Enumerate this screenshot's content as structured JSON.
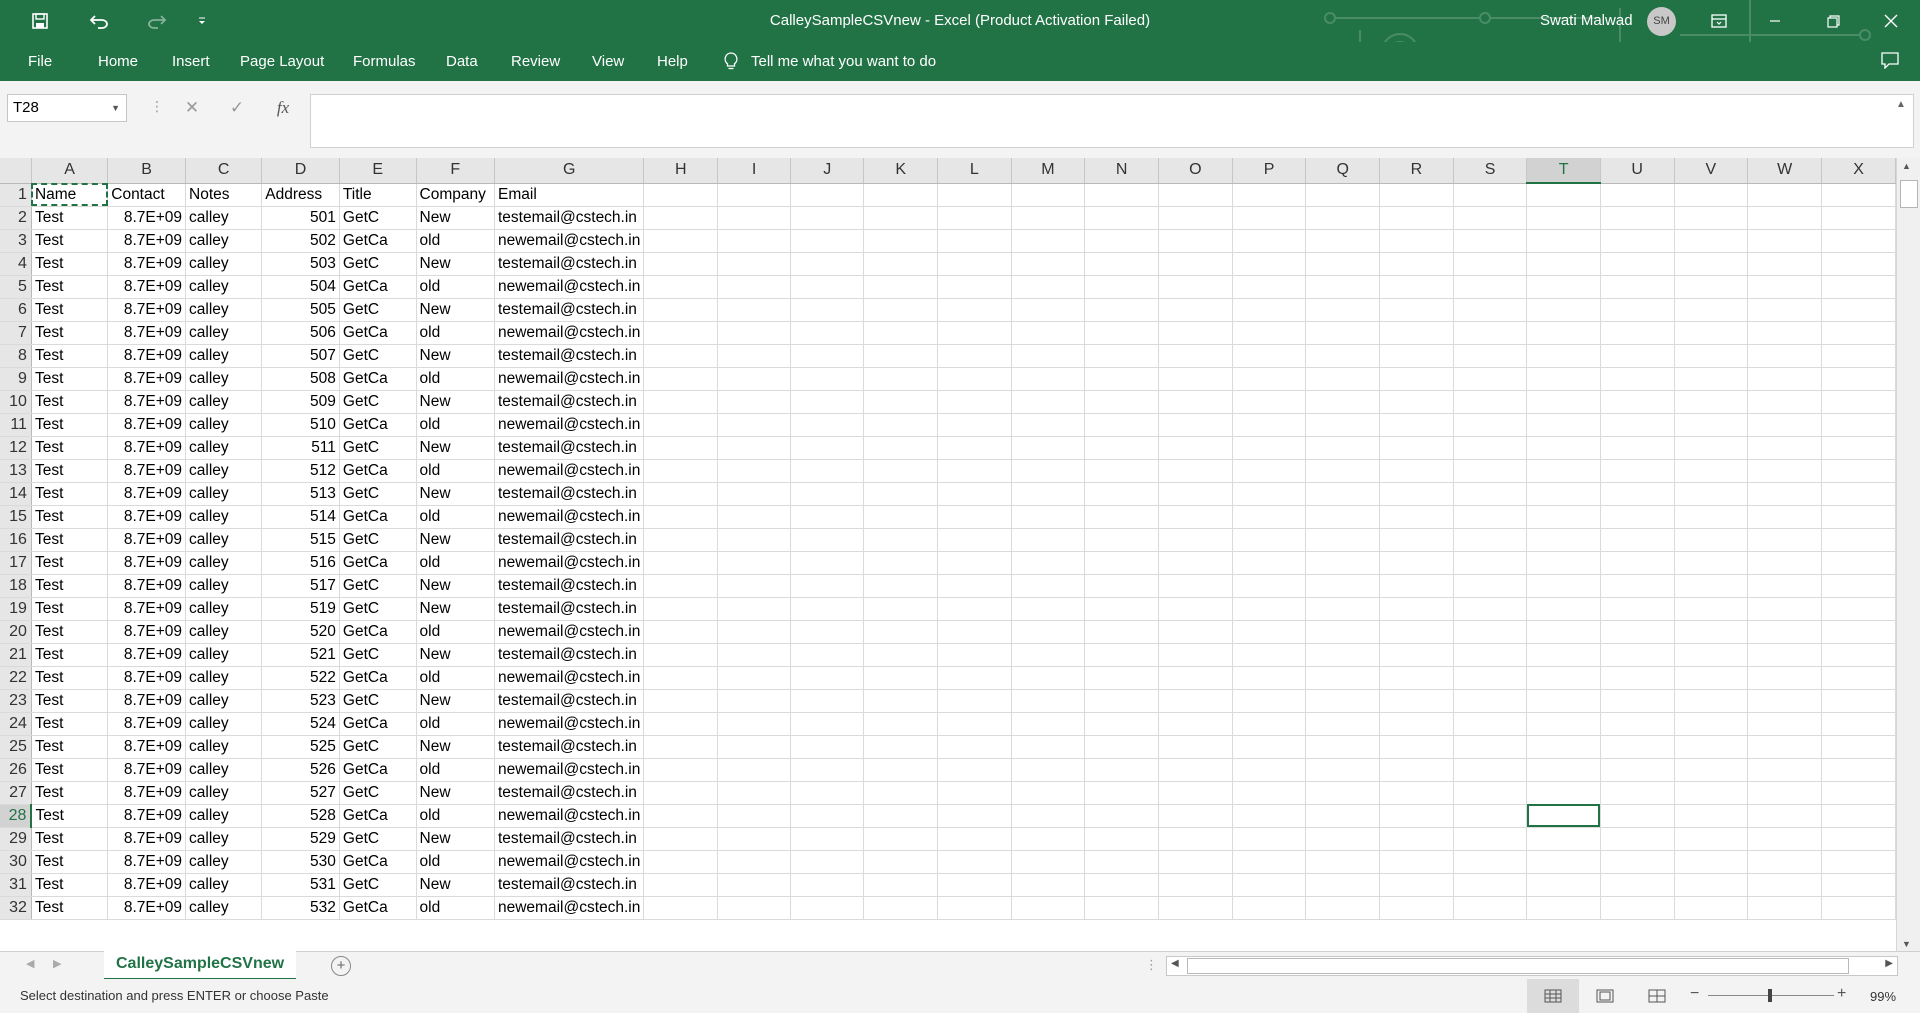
{
  "window": {
    "title": "CalleySampleCSVnew  -  Excel (Product Activation Failed)",
    "user_name": "Swati Malwad",
    "user_initials": "SM"
  },
  "ribbon": {
    "tabs": [
      "File",
      "Home",
      "Insert",
      "Page Layout",
      "Formulas",
      "Data",
      "Review",
      "View",
      "Help"
    ],
    "tell_me": "Tell me what you want to do"
  },
  "formula_bar": {
    "name_box": "T28",
    "cancel_icon": "✕",
    "enter_icon": "✓",
    "fx_label": "fx",
    "formula": ""
  },
  "sheet": {
    "columns": [
      "A",
      "B",
      "C",
      "D",
      "E",
      "F",
      "G",
      "H",
      "I",
      "J",
      "K",
      "L",
      "M",
      "N",
      "O",
      "P",
      "Q",
      "R",
      "S",
      "T",
      "U",
      "V",
      "W",
      "X"
    ],
    "header_row": [
      "Name",
      "Contact",
      "Notes",
      "Address",
      "Title",
      "Company",
      "Email"
    ],
    "rows": [
      {
        "n": "2",
        "cells": [
          "Test",
          "8.7E+09",
          "calley",
          "501",
          "GetC",
          "New",
          "testemail@cstech.in"
        ]
      },
      {
        "n": "3",
        "cells": [
          "Test",
          "8.7E+09",
          "calley",
          "502",
          "GetCa",
          "old",
          "newemail@cstech.in"
        ]
      },
      {
        "n": "4",
        "cells": [
          "Test",
          "8.7E+09",
          "calley",
          "503",
          "GetC",
          "New",
          "testemail@cstech.in"
        ]
      },
      {
        "n": "5",
        "cells": [
          "Test",
          "8.7E+09",
          "calley",
          "504",
          "GetCa",
          "old",
          "newemail@cstech.in"
        ]
      },
      {
        "n": "6",
        "cells": [
          "Test",
          "8.7E+09",
          "calley",
          "505",
          "GetC",
          "New",
          "testemail@cstech.in"
        ]
      },
      {
        "n": "7",
        "cells": [
          "Test",
          "8.7E+09",
          "calley",
          "506",
          "GetCa",
          "old",
          "newemail@cstech.in"
        ]
      },
      {
        "n": "8",
        "cells": [
          "Test",
          "8.7E+09",
          "calley",
          "507",
          "GetC",
          "New",
          "testemail@cstech.in"
        ]
      },
      {
        "n": "9",
        "cells": [
          "Test",
          "8.7E+09",
          "calley",
          "508",
          "GetCa",
          "old",
          "newemail@cstech.in"
        ]
      },
      {
        "n": "10",
        "cells": [
          "Test",
          "8.7E+09",
          "calley",
          "509",
          "GetC",
          "New",
          "testemail@cstech.in"
        ]
      },
      {
        "n": "11",
        "cells": [
          "Test",
          "8.7E+09",
          "calley",
          "510",
          "GetCa",
          "old",
          "newemail@cstech.in"
        ]
      },
      {
        "n": "12",
        "cells": [
          "Test",
          "8.7E+09",
          "calley",
          "511",
          "GetC",
          "New",
          "testemail@cstech.in"
        ]
      },
      {
        "n": "13",
        "cells": [
          "Test",
          "8.7E+09",
          "calley",
          "512",
          "GetCa",
          "old",
          "newemail@cstech.in"
        ]
      },
      {
        "n": "14",
        "cells": [
          "Test",
          "8.7E+09",
          "calley",
          "513",
          "GetC",
          "New",
          "testemail@cstech.in"
        ]
      },
      {
        "n": "15",
        "cells": [
          "Test",
          "8.7E+09",
          "calley",
          "514",
          "GetCa",
          "old",
          "newemail@cstech.in"
        ]
      },
      {
        "n": "16",
        "cells": [
          "Test",
          "8.7E+09",
          "calley",
          "515",
          "GetC",
          "New",
          "testemail@cstech.in"
        ]
      },
      {
        "n": "17",
        "cells": [
          "Test",
          "8.7E+09",
          "calley",
          "516",
          "GetCa",
          "old",
          "newemail@cstech.in"
        ]
      },
      {
        "n": "18",
        "cells": [
          "Test",
          "8.7E+09",
          "calley",
          "517",
          "GetC",
          "New",
          "testemail@cstech.in"
        ]
      },
      {
        "n": "19",
        "cells": [
          "Test",
          "8.7E+09",
          "calley",
          "519",
          "GetC",
          "New",
          "testemail@cstech.in"
        ]
      },
      {
        "n": "20",
        "cells": [
          "Test",
          "8.7E+09",
          "calley",
          "520",
          "GetCa",
          "old",
          "newemail@cstech.in"
        ]
      },
      {
        "n": "21",
        "cells": [
          "Test",
          "8.7E+09",
          "calley",
          "521",
          "GetC",
          "New",
          "testemail@cstech.in"
        ]
      },
      {
        "n": "22",
        "cells": [
          "Test",
          "8.7E+09",
          "calley",
          "522",
          "GetCa",
          "old",
          "newemail@cstech.in"
        ]
      },
      {
        "n": "23",
        "cells": [
          "Test",
          "8.7E+09",
          "calley",
          "523",
          "GetC",
          "New",
          "testemail@cstech.in"
        ]
      },
      {
        "n": "24",
        "cells": [
          "Test",
          "8.7E+09",
          "calley",
          "524",
          "GetCa",
          "old",
          "newemail@cstech.in"
        ]
      },
      {
        "n": "25",
        "cells": [
          "Test",
          "8.7E+09",
          "calley",
          "525",
          "GetC",
          "New",
          "testemail@cstech.in"
        ]
      },
      {
        "n": "26",
        "cells": [
          "Test",
          "8.7E+09",
          "calley",
          "526",
          "GetCa",
          "old",
          "newemail@cstech.in"
        ]
      },
      {
        "n": "27",
        "cells": [
          "Test",
          "8.7E+09",
          "calley",
          "527",
          "GetC",
          "New",
          "testemail@cstech.in"
        ]
      },
      {
        "n": "28",
        "cells": [
          "Test",
          "8.7E+09",
          "calley",
          "528",
          "GetCa",
          "old",
          "newemail@cstech.in"
        ]
      },
      {
        "n": "29",
        "cells": [
          "Test",
          "8.7E+09",
          "calley",
          "529",
          "GetC",
          "New",
          "testemail@cstech.in"
        ]
      },
      {
        "n": "30",
        "cells": [
          "Test",
          "8.7E+09",
          "calley",
          "530",
          "GetCa",
          "old",
          "newemail@cstech.in"
        ]
      },
      {
        "n": "31",
        "cells": [
          "Test",
          "8.7E+09",
          "calley",
          "531",
          "GetC",
          "New",
          "testemail@cstech.in"
        ]
      },
      {
        "n": "32",
        "cells": [
          "Test",
          "8.7E+09",
          "calley",
          "532",
          "GetCa",
          "old",
          "newemail@cstech.in"
        ]
      }
    ],
    "active_cell": "T28",
    "copy_range": "A1"
  },
  "sheet_tabs": {
    "active": "CalleySampleCSVnew"
  },
  "status_bar": {
    "message": "Select destination and press ENTER or choose Paste",
    "zoom": "99%"
  },
  "colors": {
    "accent": "#217346"
  },
  "icons": [
    "save-icon",
    "undo-icon",
    "redo-icon",
    "customize-qat-icon",
    "ribbon-display-icon",
    "minimize-icon",
    "restore-icon",
    "close-icon",
    "lightbulb-icon",
    "comments-icon",
    "normal-view-icon",
    "page-layout-view-icon",
    "page-break-view-icon"
  ]
}
